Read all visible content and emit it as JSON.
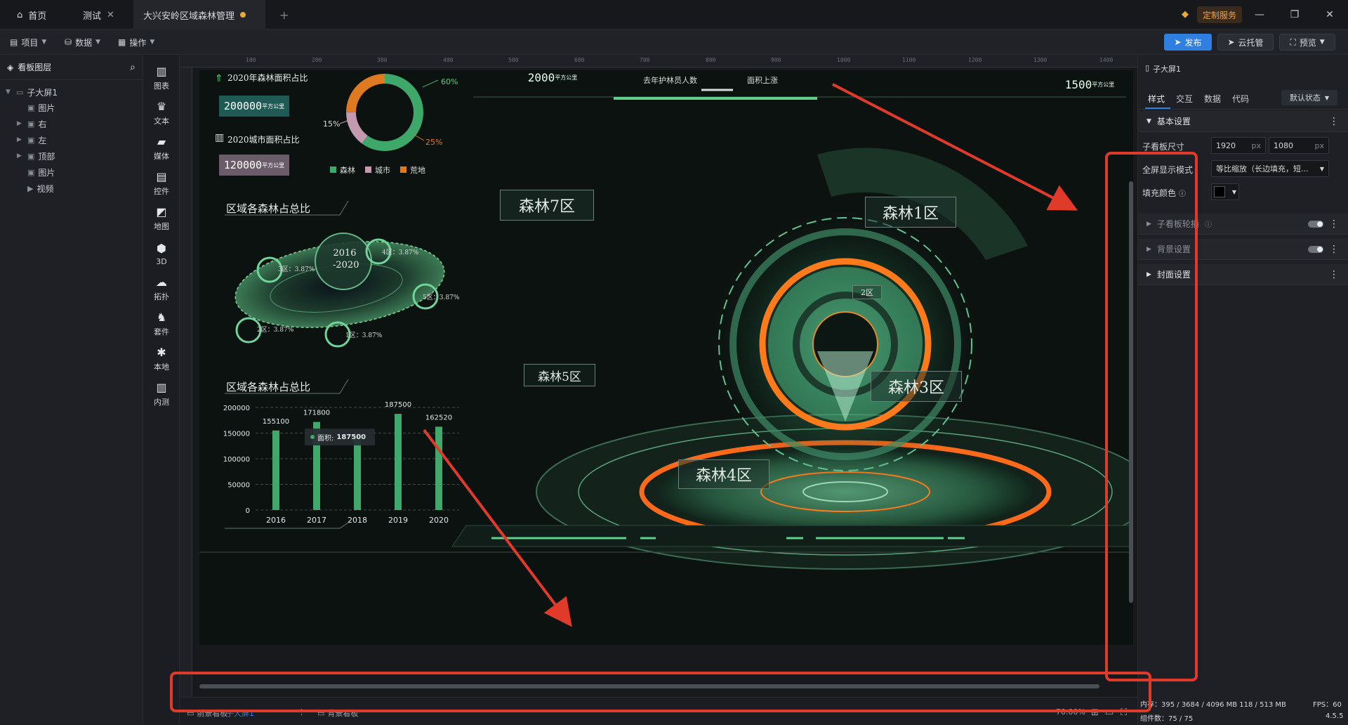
{
  "tabs": [
    {
      "label": "首页"
    },
    {
      "label": "测试"
    },
    {
      "label": "大兴安岭区域森林管理"
    }
  ],
  "top": {
    "custom_service": "定制服务"
  },
  "toolbar": {
    "project": "项目",
    "data": "数据",
    "operate": "操作",
    "publish": "发布",
    "cloud": "云托管",
    "preview": "预览"
  },
  "layers": {
    "header": "看板图层",
    "items": [
      {
        "label": "子大屏1"
      },
      {
        "label": "图片"
      },
      {
        "label": "右"
      },
      {
        "label": "左"
      },
      {
        "label": "顶部"
      },
      {
        "label": "图片"
      },
      {
        "label": "视频"
      }
    ]
  },
  "iconbar": [
    {
      "label": "图表",
      "icon": "chart-icon"
    },
    {
      "label": "文本",
      "icon": "text-icon"
    },
    {
      "label": "媒体",
      "icon": "media-icon"
    },
    {
      "label": "控件",
      "icon": "widget-icon"
    },
    {
      "label": "地图",
      "icon": "map-icon"
    },
    {
      "label": "3D",
      "icon": "cube-icon"
    },
    {
      "label": "拓扑",
      "icon": "topology-icon"
    },
    {
      "label": "套件",
      "icon": "kit-icon"
    },
    {
      "label": "本地",
      "icon": "local-icon"
    },
    {
      "label": "内测",
      "icon": "beta-icon"
    }
  ],
  "ruler": [
    "100",
    "200",
    "300",
    "400",
    "500",
    "600",
    "700",
    "800",
    "900",
    "1000",
    "1100",
    "1200",
    "1300",
    "1400"
  ],
  "screen": {
    "forest_area_title": "2020年森林面积占比",
    "forest_area_value": "200000",
    "city_area_title": "2020城市面积占比",
    "city_area_value": "120000",
    "unit": "平方公里",
    "donut_labels": {
      "forest": "60%",
      "city": "15%",
      "waste": "25%"
    },
    "legend": [
      "森林",
      "城市",
      "荒地"
    ],
    "region_title_1": "区域各森林占总比",
    "region_title_2": "区域各森林占总比",
    "orbit_center": "2016\n-2020",
    "orbit_center_line1": "2016",
    "orbit_center_line2": "-2020",
    "orbit_labels": [
      "3区：3.87%",
      "4区：3.87%",
      "5区：3.87%",
      "2区：3.87%",
      "1区：3.87%"
    ],
    "top_value_1": "2000",
    "top_value_2": "1500",
    "top_label_1": "去年护林员人数",
    "top_label_2": "面积上涨",
    "zones": [
      "森林7区",
      "森林1区",
      "森林5区",
      "森林3区",
      "森林4区",
      "2区"
    ],
    "tooltip": {
      "label": "面积:",
      "value": "187500"
    }
  },
  "chart_data": {
    "type": "bar",
    "categories": [
      "2016",
      "2017",
      "2018",
      "2019",
      "2020"
    ],
    "values": [
      155100,
      171800,
      150000,
      187500,
      162520
    ],
    "value_labels": [
      "155100",
      "171800",
      "",
      "187500",
      "162520"
    ],
    "yticks": [
      "200000",
      "150000",
      "100000",
      "50000",
      "0"
    ],
    "ylim": [
      0,
      200000
    ],
    "colors": {
      "bar": "#3fa86a",
      "grid": "#3b4a44"
    }
  },
  "rightpanel": {
    "title": "子大屏1",
    "tabs": [
      "样式",
      "交互",
      "数据",
      "代码"
    ],
    "state": "默认状态",
    "basic": "基本设置",
    "size_label": "子看板尺寸",
    "width": "1920",
    "height": "1080",
    "px": "px",
    "fullscreen_label": "全屏显示模式",
    "fullscreen_value": "等比缩放（长边填充，短...",
    "fill_label": "填充颜色",
    "sections": [
      "子看板轮播",
      "背景设置",
      "封面设置"
    ]
  },
  "bottom": {
    "tab1": "前景看板",
    "tab2": "子大屏1",
    "tab3": "背景看板",
    "zoom": "70.00%"
  },
  "status": {
    "memory": "内存：395 / 3684 / 4096 MB  118 / 513 MB",
    "fps": "FPS：60",
    "components": "组件数：75 / 75",
    "version": "4.5.5"
  },
  "colors": {
    "accent": "#2f7fe0",
    "annotation": "#e03a2b",
    "green": "#3fcf7f",
    "orange": "#ff7a1a"
  }
}
